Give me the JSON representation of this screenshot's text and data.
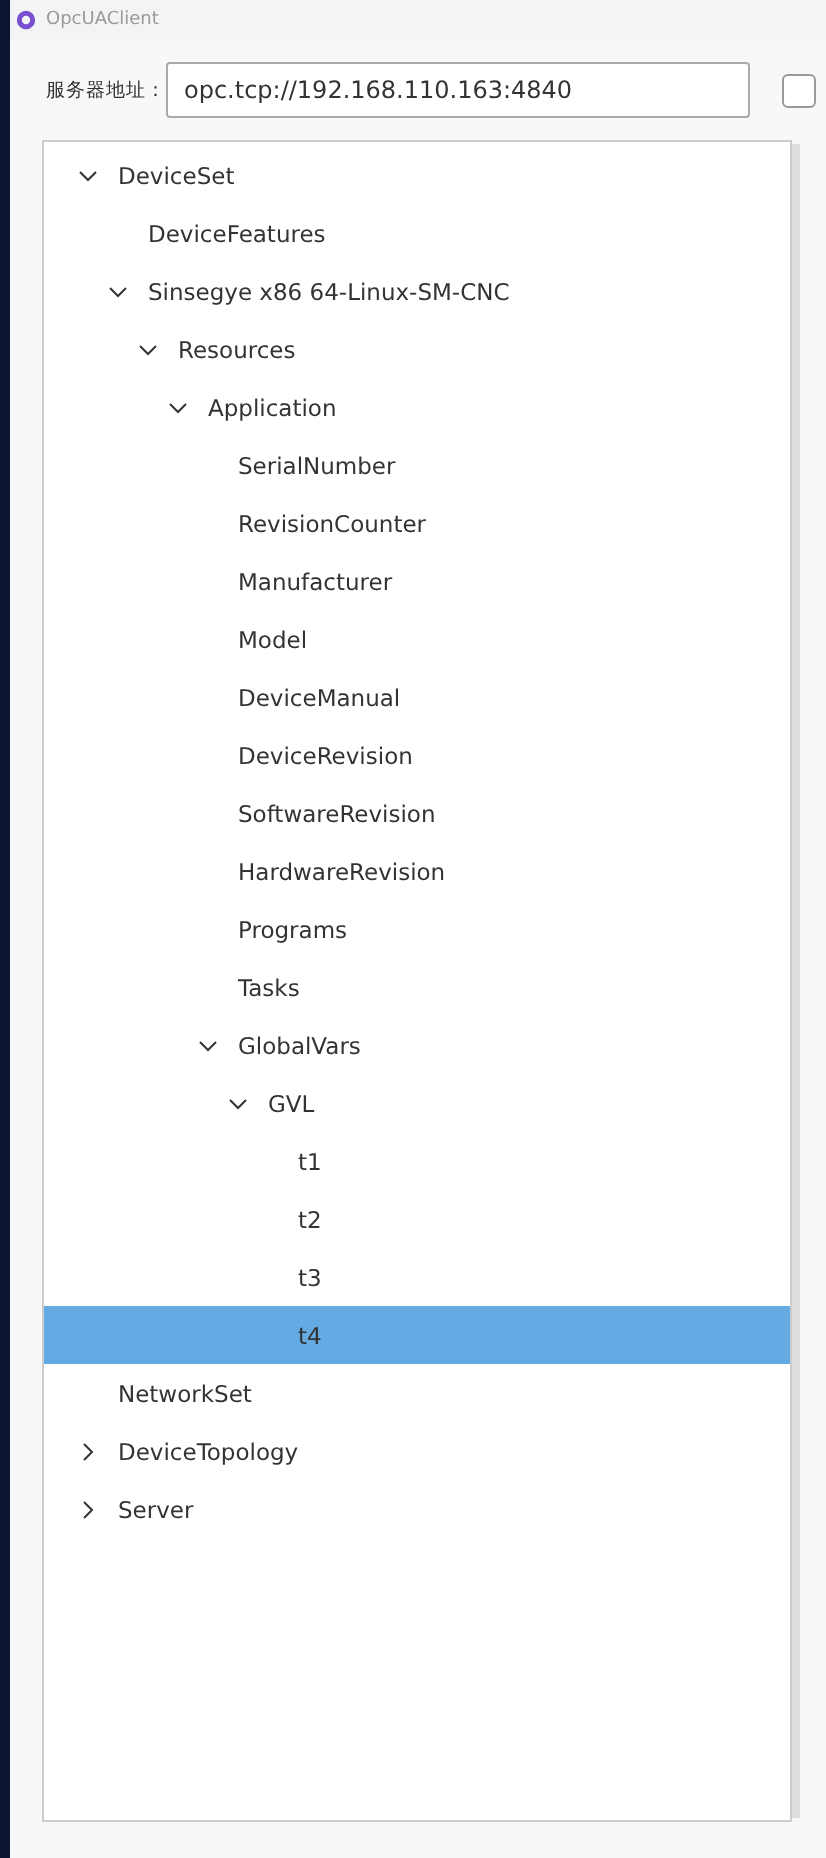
{
  "window": {
    "title": "OpcUAClient"
  },
  "server": {
    "label": "服务器地址：",
    "value": "opc.tcp://192.168.110.163:4840",
    "checked": false
  },
  "tree": [
    {
      "label": "DeviceSet",
      "expanded": true,
      "selected": false,
      "children": [
        {
          "label": "DeviceFeatures",
          "selected": false
        },
        {
          "label": "Sinsegye x86 64-Linux-SM-CNC",
          "expanded": true,
          "selected": false,
          "children": [
            {
              "label": "Resources",
              "expanded": true,
              "selected": false,
              "children": [
                {
                  "label": "Application",
                  "expanded": true,
                  "selected": false,
                  "children": [
                    {
                      "label": "SerialNumber",
                      "selected": false
                    },
                    {
                      "label": "RevisionCounter",
                      "selected": false
                    },
                    {
                      "label": "Manufacturer",
                      "selected": false
                    },
                    {
                      "label": "Model",
                      "selected": false
                    },
                    {
                      "label": "DeviceManual",
                      "selected": false
                    },
                    {
                      "label": "DeviceRevision",
                      "selected": false
                    },
                    {
                      "label": "SoftwareRevision",
                      "selected": false
                    },
                    {
                      "label": "HardwareRevision",
                      "selected": false
                    },
                    {
                      "label": "Programs",
                      "selected": false
                    },
                    {
                      "label": "Tasks",
                      "selected": false
                    },
                    {
                      "label": "GlobalVars",
                      "expanded": true,
                      "selected": false,
                      "children": [
                        {
                          "label": "GVL",
                          "expanded": true,
                          "selected": false,
                          "children": [
                            {
                              "label": "t1",
                              "selected": false
                            },
                            {
                              "label": "t2",
                              "selected": false
                            },
                            {
                              "label": "t3",
                              "selected": false
                            },
                            {
                              "label": "t4",
                              "selected": true
                            }
                          ]
                        }
                      ]
                    }
                  ]
                }
              ]
            }
          ]
        }
      ]
    },
    {
      "label": "NetworkSet",
      "selected": false
    },
    {
      "label": "DeviceTopology",
      "expanded": false,
      "selected": false
    },
    {
      "label": "Server",
      "expanded": false,
      "selected": false
    }
  ]
}
